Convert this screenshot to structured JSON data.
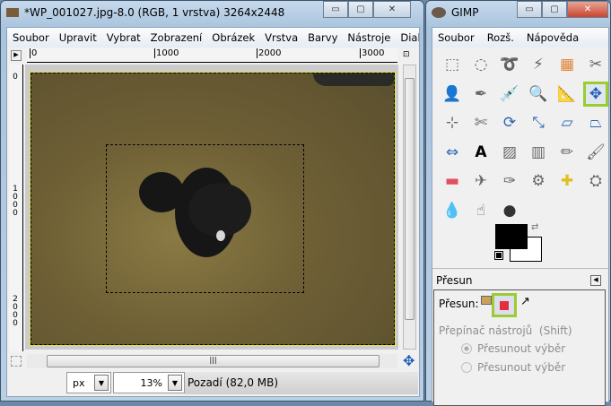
{
  "image_window": {
    "title": "*WP_001027.jpg-8.0 (RGB, 1 vrstva) 3264x2448",
    "menu": [
      "Soubor",
      "Upravit",
      "Vybrat",
      "Zobrazení",
      "Obrázek",
      "Vrstva",
      "Barvy",
      "Nástroje",
      "Dialo"
    ],
    "hruler": [
      "0",
      "1000",
      "2000",
      "3000"
    ],
    "vruler": [
      "0",
      "1000",
      "2000"
    ],
    "unit": "px",
    "zoom": "13%",
    "status": "Pozadí (82,0 MB)"
  },
  "toolbox": {
    "title": "GIMP",
    "menu": [
      "Soubor",
      "Rozš.",
      "Nápověda"
    ],
    "tools": [
      "rect-select",
      "ellipse-select",
      "free-select",
      "fuzzy-select",
      "select-by-color",
      "scissors",
      "foreground-select",
      "paths",
      "color-picker",
      "zoom",
      "measure",
      "move",
      "align",
      "crop",
      "rotate",
      "scale",
      "shear",
      "perspective",
      "flip",
      "text",
      "bucket-fill",
      "blend",
      "pencil",
      "paintbrush",
      "eraser",
      "airbrush",
      "ink",
      "clone",
      "heal",
      "perspective-clone",
      "blur",
      "smudge",
      "dodge-burn"
    ],
    "fg_color": "#000000",
    "bg_color": "#ffffff",
    "options_title": "Přesun",
    "move_label": "Přesun:",
    "switch_label": "Přepínač nástrojů  (Shift)",
    "radio1": "Přesunout výběr",
    "radio2": "Přesunout výběr"
  }
}
